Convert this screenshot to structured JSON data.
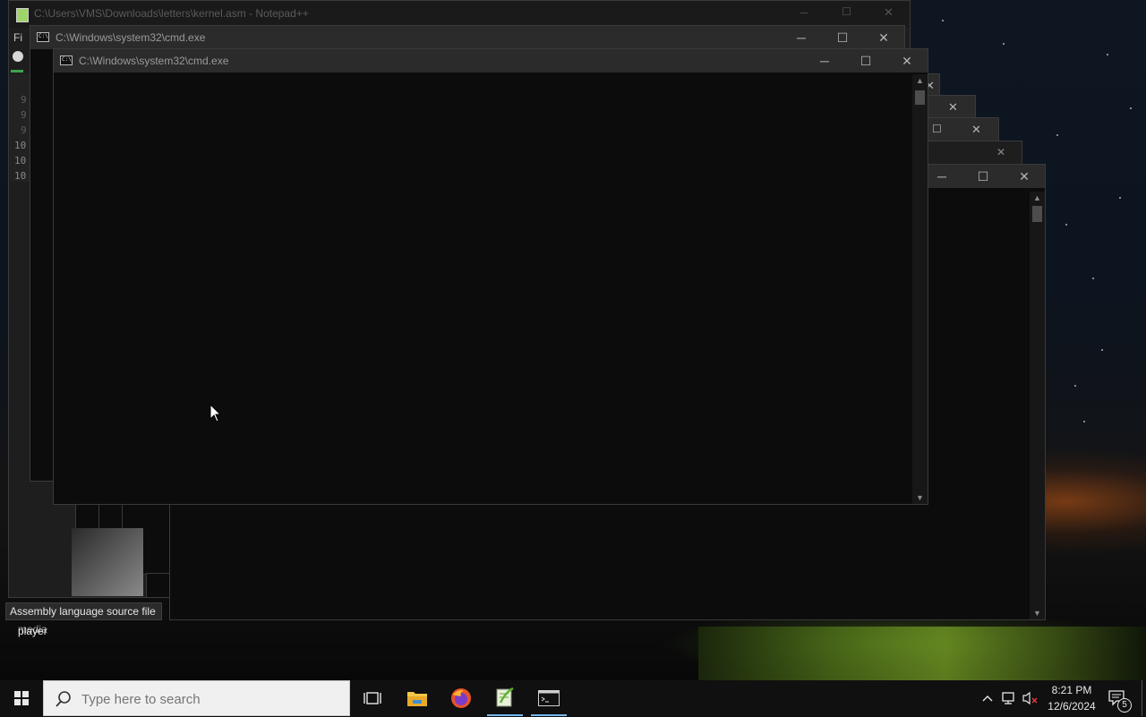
{
  "desktop": {
    "tooltip": "Assembly language source file",
    "icon_label_partial": "VLC media",
    "icon_label": "player"
  },
  "notepad_window": {
    "title": "C:\\Users\\VMS\\Downloads\\letters\\kernel.asm - Notepad++",
    "menu_first": "Fi",
    "line_numbers": [
      "9",
      "9",
      "9",
      "10",
      "10",
      "10"
    ]
  },
  "cmd_back": {
    "title": "C:\\Windows\\system32\\cmd.exe"
  },
  "cmd_front": {
    "title": "C:\\Windows\\system32\\cmd.exe"
  },
  "window_controls": {
    "minimize": "─",
    "maximize": "☐",
    "close": "✕"
  },
  "taskbar": {
    "search_placeholder": "Type here to search",
    "apps": [
      "task-view",
      "file-explorer",
      "firefox",
      "notepad-plus-plus",
      "command-prompt"
    ],
    "tray": {
      "time": "8:21 PM",
      "date": "12/6/2024",
      "notification_count": "5"
    }
  },
  "colors": {
    "console_bg": "#0c0c0c",
    "titlebar_bg": "#2b2b2b",
    "taskbar_bg": "#101010",
    "accent": "#76b9ed"
  }
}
